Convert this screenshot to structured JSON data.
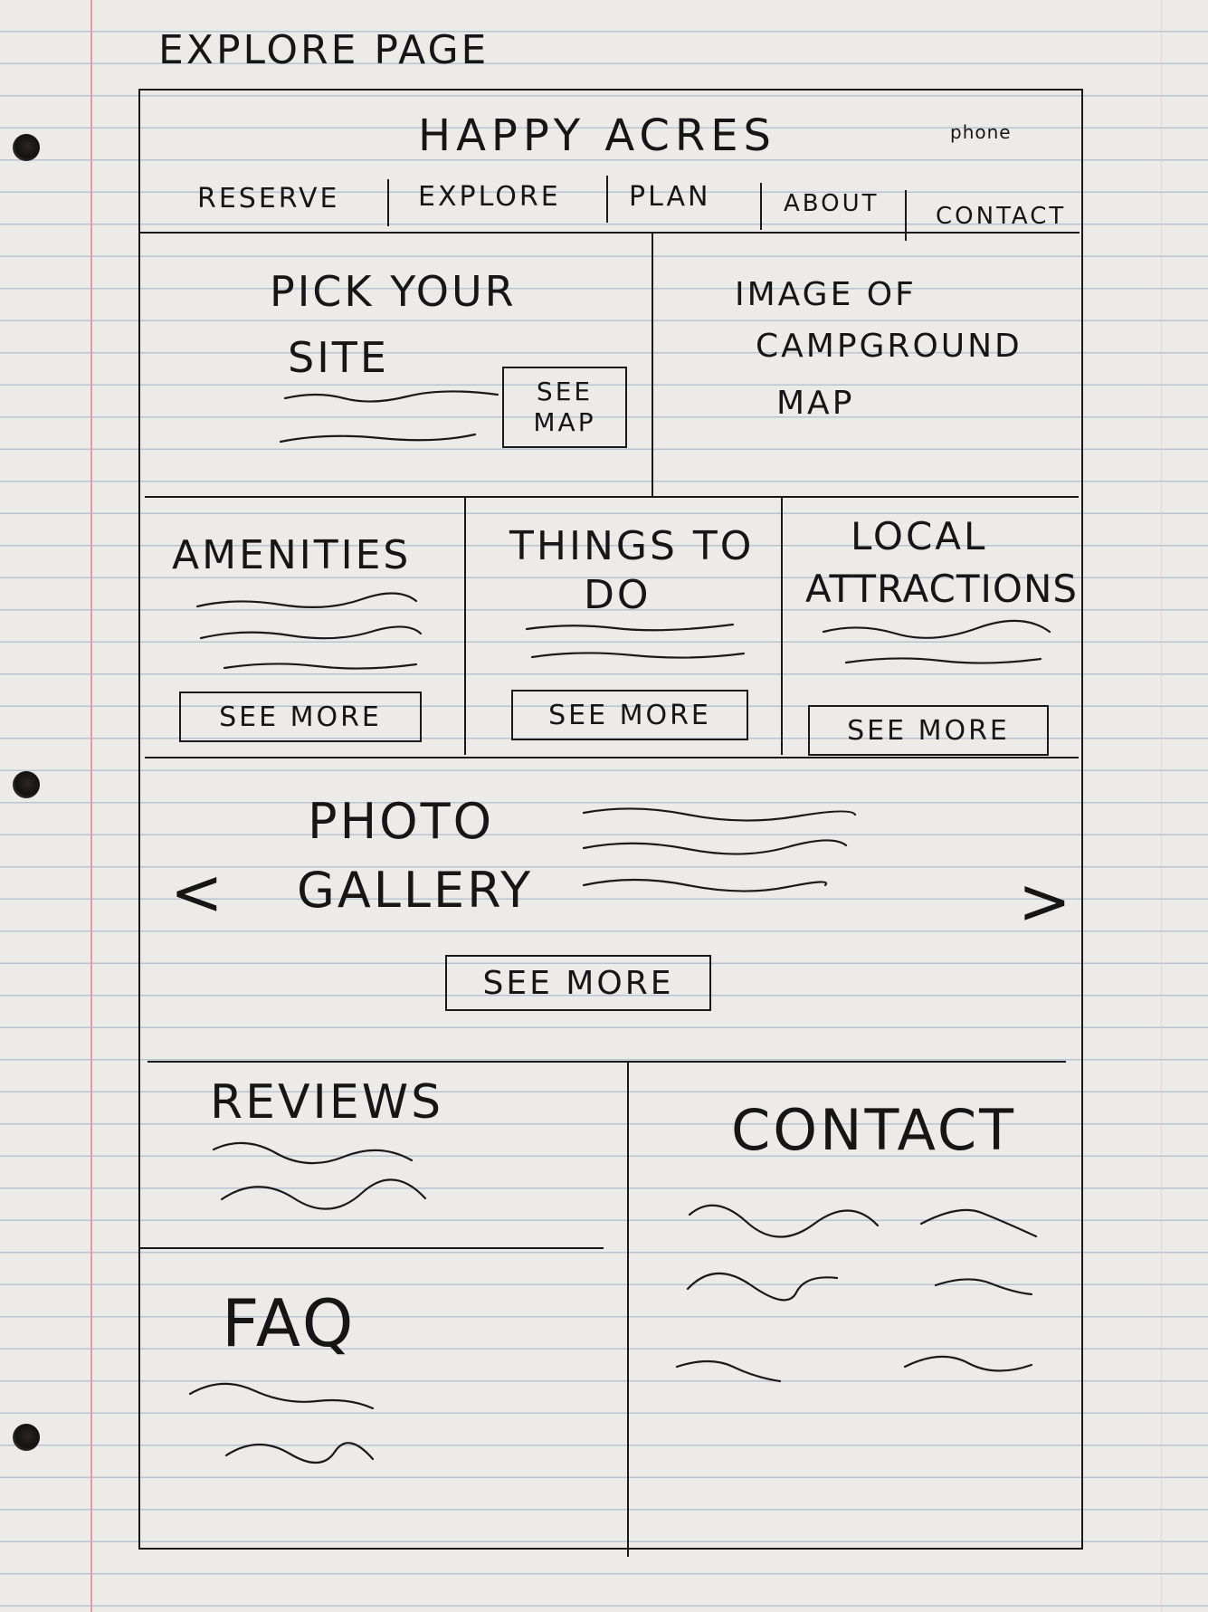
{
  "page_label": "EXPLORE PAGE",
  "header": {
    "logo": "HAPPY ACRES",
    "phone": "phone",
    "nav": [
      "RESERVE",
      "EXPLORE",
      "PLAN",
      "ABOUT",
      "CONTACT"
    ]
  },
  "pick_site": {
    "title_line1": "PICK YOUR",
    "title_line2": "SITE",
    "button_line1": "SEE",
    "button_line2": "MAP"
  },
  "map_image": {
    "line1": "IMAGE OF",
    "line2": "CAMPGROUND",
    "line3": "MAP"
  },
  "amenities": {
    "title": "AMENITIES",
    "button": "SEE MORE"
  },
  "things_to_do": {
    "title_line1": "THINGS TO",
    "title_line2": "DO",
    "button": "SEE MORE"
  },
  "local_attractions": {
    "title_line1": "LOCAL",
    "title_line2": "ATTRACTIONS",
    "button": "SEE MORE"
  },
  "gallery": {
    "title_line1": "PHOTO",
    "title_line2": "GALLERY",
    "prev": "<",
    "next": ">",
    "button": "SEE MORE"
  },
  "reviews": {
    "title": "REVIEWS"
  },
  "faq": {
    "title": "FAQ"
  },
  "contact": {
    "title": "CONTACT"
  },
  "colors": {
    "paper": "#ecebe8",
    "ink": "#1a1a1a",
    "rule": "#b9c3d3",
    "margin": "#e79aa6"
  }
}
